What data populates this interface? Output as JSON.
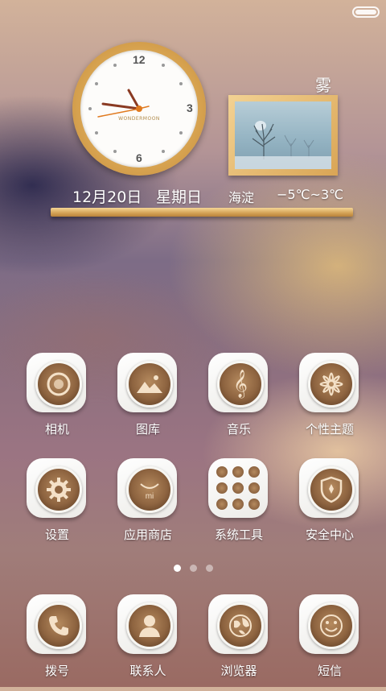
{
  "clock": {
    "brand": "WONDERMOON",
    "numerals": {
      "twelve": "12",
      "three": "3",
      "six": "6"
    }
  },
  "weather": {
    "condition": "雾",
    "date": "12月20日",
    "weekday": "星期日",
    "district": "海淀",
    "temperature": "−5℃~3℃"
  },
  "apps_row1": [
    {
      "label": "相机",
      "icon": "camera-icon"
    },
    {
      "label": "图库",
      "icon": "gallery-icon"
    },
    {
      "label": "音乐",
      "icon": "music-icon"
    },
    {
      "label": "个性主题",
      "icon": "theme-icon"
    }
  ],
  "apps_row2": [
    {
      "label": "设置",
      "icon": "gear-icon"
    },
    {
      "label": "应用商店",
      "icon": "store-icon"
    },
    {
      "label": "系统工具",
      "icon": "tools-grid-icon"
    },
    {
      "label": "安全中心",
      "icon": "shield-icon"
    }
  ],
  "pager": {
    "count": 3,
    "active": 0
  },
  "dock": [
    {
      "label": "拨号",
      "icon": "phone-icon"
    },
    {
      "label": "联系人",
      "icon": "contacts-icon"
    },
    {
      "label": "浏览器",
      "icon": "globe-icon"
    },
    {
      "label": "短信",
      "icon": "smiley-icon"
    }
  ]
}
